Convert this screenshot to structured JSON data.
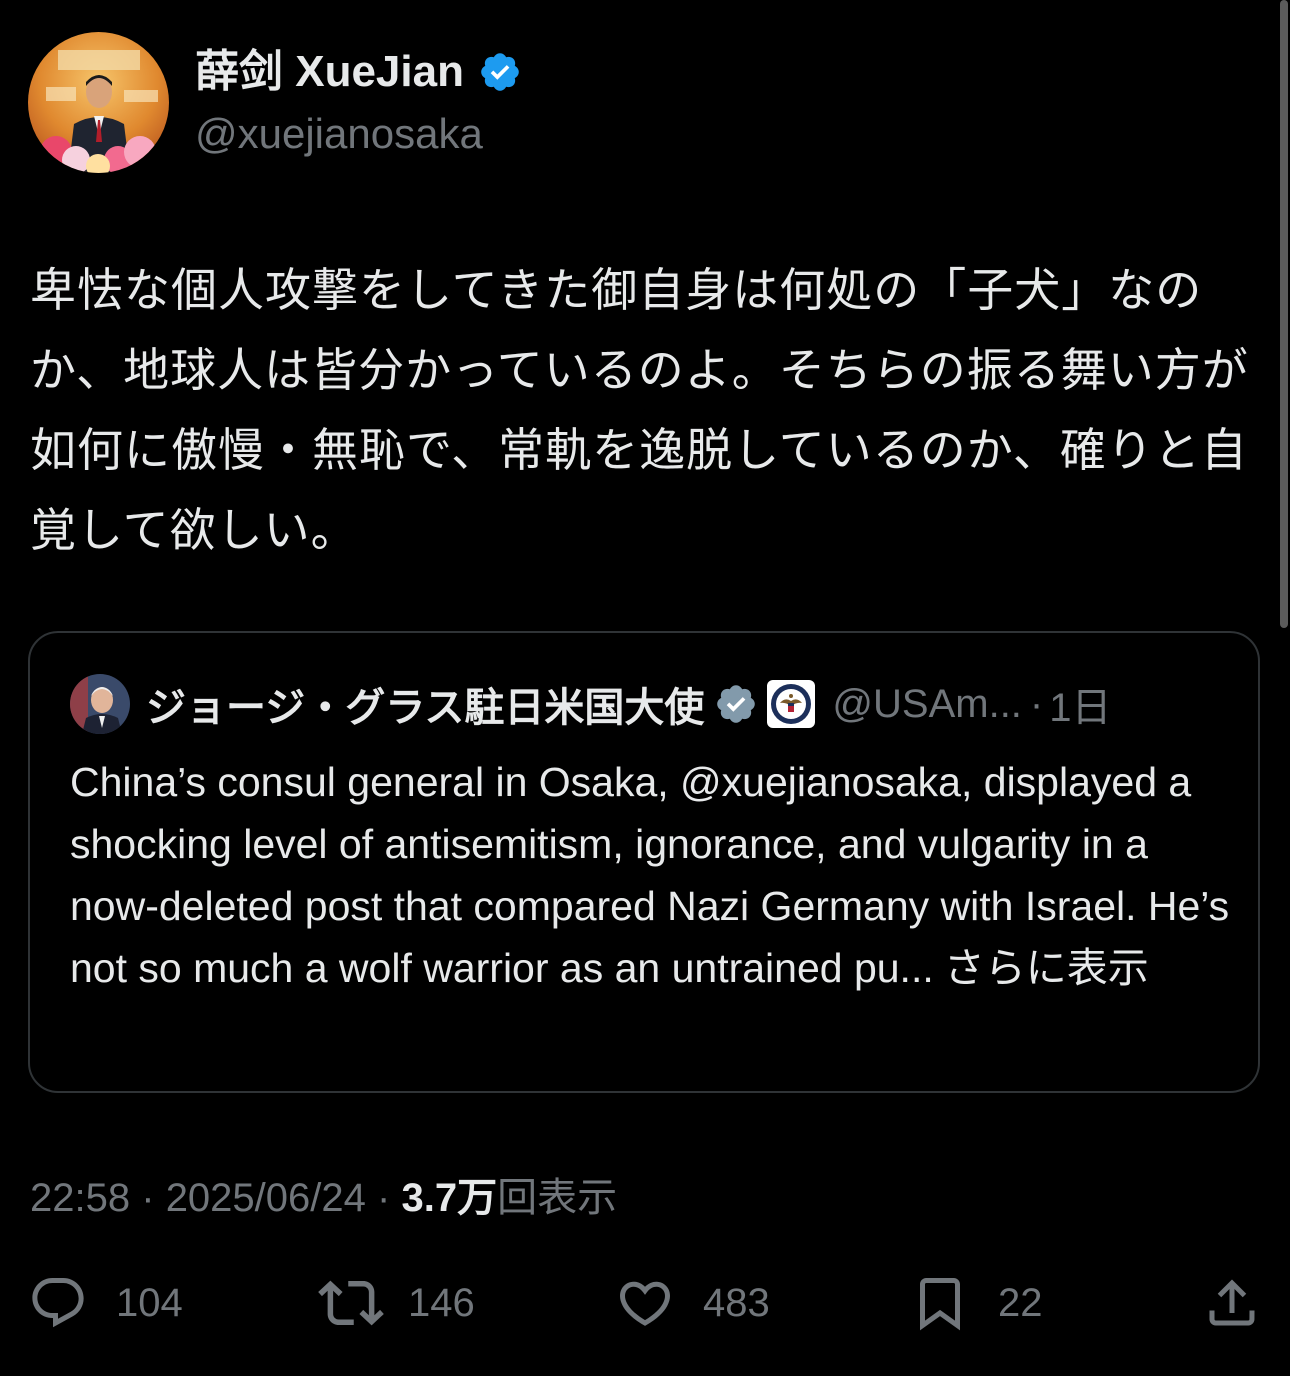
{
  "author": {
    "display_name": "薛剑 XueJian",
    "handle": "@xuejianosaka",
    "verified": true,
    "avatar_icon": "avatar-photo"
  },
  "post": {
    "text": "卑怯な個人攻撃をしてきた御自身は何処の「子犬」なのか、地球人は皆分かっているのよ。そちらの振る舞い方が如何に傲慢・無恥で、常軌を逸脱しているのか、確りと自覚して欲しい。",
    "time": "22:58",
    "date": "2025/06/24",
    "separator": "·",
    "views_count": "3.7万",
    "views_label": "回表示"
  },
  "quote": {
    "display_name": "ジョージ・グラス駐日米国大使",
    "handle": "@USAm...",
    "separator": "·",
    "time": "1日",
    "verified": true,
    "affiliation_icon": "state-department-seal-icon",
    "text": "China’s consul general in Osaka, @xuejianosaka, displayed a shocking level of antisemitism, ignorance, and vulgarity in a now-deleted post that compared Nazi Germany with Israel. He’s not so much a wolf warrior as an untrained pu...",
    "show_more": "さらに表示"
  },
  "actions": {
    "reply": {
      "icon": "reply-icon",
      "count": "104"
    },
    "repost": {
      "icon": "repost-icon",
      "count": "146"
    },
    "like": {
      "icon": "heart-icon",
      "count": "483"
    },
    "bookmark": {
      "icon": "bookmark-icon",
      "count": "22"
    },
    "share": {
      "icon": "share-icon"
    }
  },
  "colors": {
    "background": "#000000",
    "primary_text": "#e7e9ea",
    "secondary_text": "#71767b",
    "verified_blue": "#1d9bf0",
    "verified_gray": "#829aab",
    "border": "#2f3336"
  }
}
